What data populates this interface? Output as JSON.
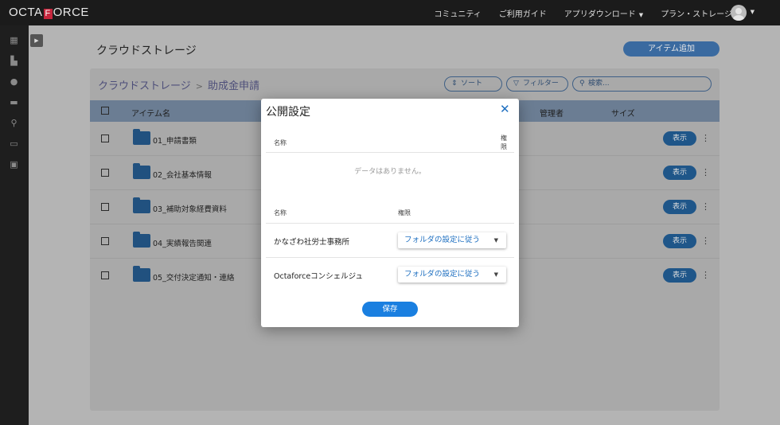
{
  "header": {
    "logo_left": "OCTA",
    "logo_mark": "F",
    "logo_right": "ORCE",
    "nav": [
      "コミュニティ",
      "ご利用ガイド",
      "アプリダウンロード",
      "プラン・ストレージ"
    ]
  },
  "sidebar": {
    "icons": [
      "dashboard-icon",
      "book-icon",
      "chat-icon",
      "archive-icon",
      "search-icon",
      "card-icon",
      "contact-icon"
    ]
  },
  "page": {
    "title": "クラウドストレージ",
    "add_button": "アイテム追加",
    "breadcrumb": [
      "クラウドストレージ",
      "助成金申請"
    ],
    "breadcrumb_sep": ">",
    "sort_label": "ソート",
    "filter_label": "フィルター",
    "search_placeholder": "検索..."
  },
  "table": {
    "columns": {
      "name": "アイテム名",
      "manager": "管理者",
      "size": "サイズ"
    },
    "view_label": "表示",
    "rows": [
      {
        "name": "01_申請書類"
      },
      {
        "name": "02_会社基本情報"
      },
      {
        "name": "03_補助対象経費資料"
      },
      {
        "name": "04_実績報告関連"
      },
      {
        "name": "05_交付決定通知・連絡"
      }
    ]
  },
  "modal": {
    "title": "公開設定",
    "col_name": "名称",
    "col_permission_line1": "権",
    "col_permission_line2": "限",
    "empty_text": "データはありません。",
    "col_name2": "名称",
    "col_permission2": "権限",
    "entries": [
      {
        "name": "かなざわ社労士事務所",
        "permission": "フォルダの設定に従う"
      },
      {
        "name": "Octaforceコンシェルジュ",
        "permission": "フォルダの設定に従う"
      }
    ],
    "save_label": "保存"
  }
}
